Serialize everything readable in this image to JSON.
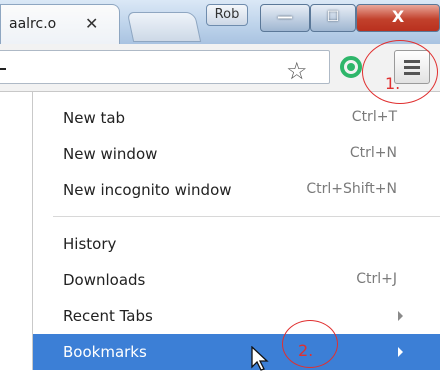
{
  "browser": {
    "tab_title": "aalrc.o",
    "tab_close": "✕",
    "profile_name": "Rob",
    "minimize": "—",
    "maximize": "☐",
    "close": "X"
  },
  "toolbar": {
    "star_icon": "star-icon",
    "extension_icon": "extension-icon",
    "menu_icon": "hamburger-menu-icon"
  },
  "menu": {
    "items": [
      {
        "label": "New tab",
        "shortcut": "Ctrl+T"
      },
      {
        "label": "New window",
        "shortcut": "Ctrl+N"
      },
      {
        "label": "New incognito window",
        "shortcut": "Ctrl+Shift+N"
      },
      {
        "label": "History",
        "shortcut": ""
      },
      {
        "label": "Downloads",
        "shortcut": "Ctrl+J"
      },
      {
        "label": "Recent Tabs",
        "shortcut": ""
      },
      {
        "label": "Bookmarks",
        "shortcut": ""
      }
    ],
    "selected_color": "#3c7fd6"
  },
  "annotations": {
    "step1": "1.",
    "step2": "2.",
    "color": "#e03030"
  }
}
